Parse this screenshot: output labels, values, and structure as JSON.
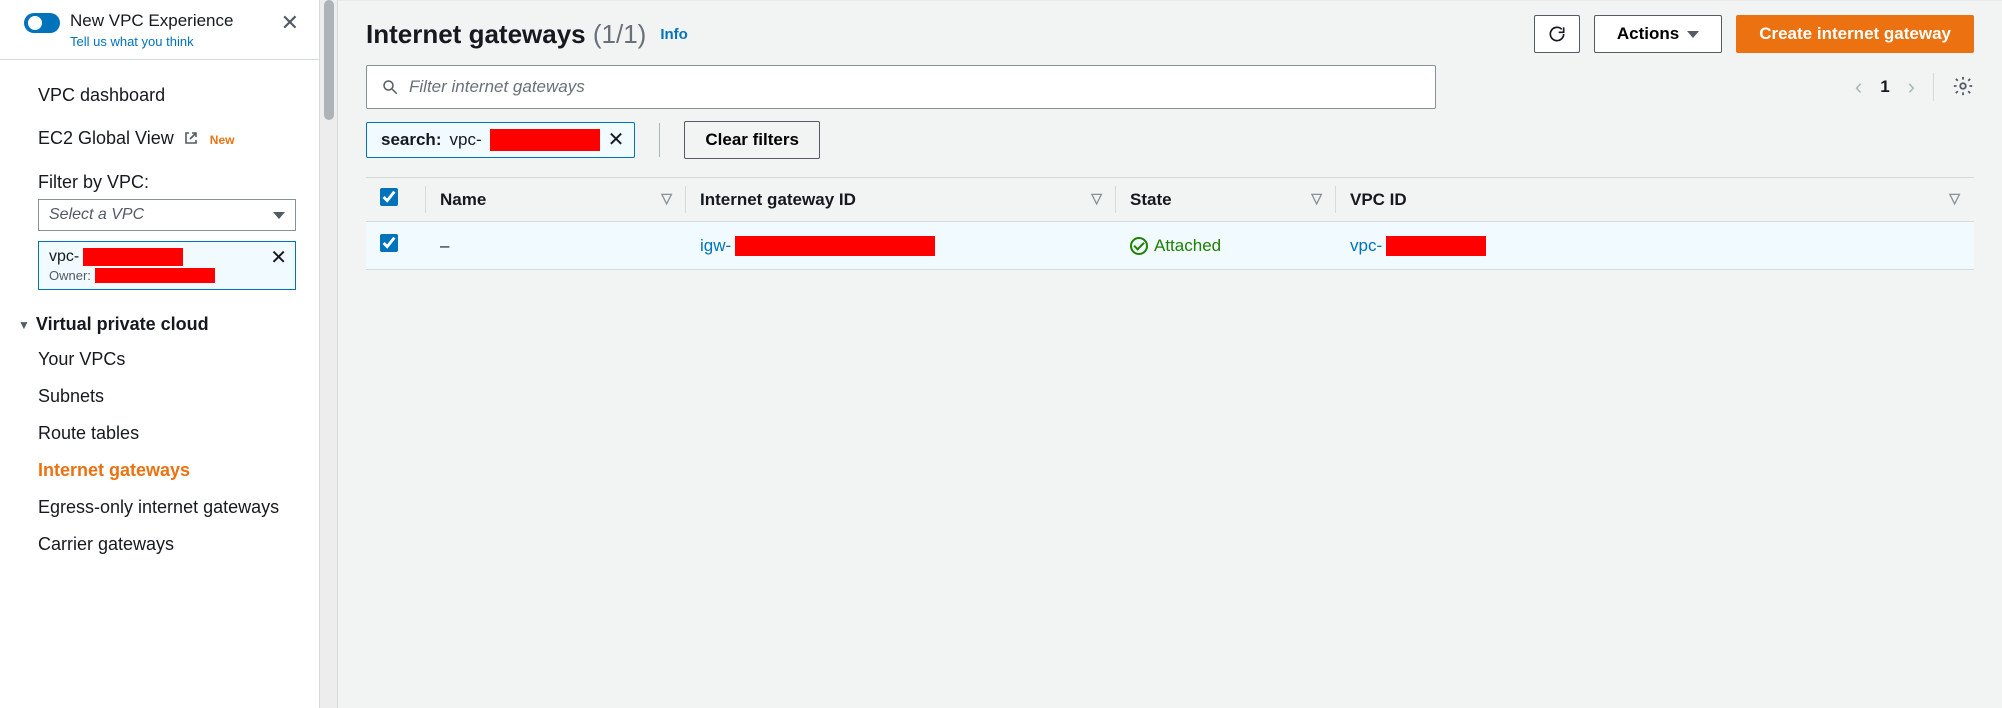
{
  "sidebar": {
    "toggle_title": "New VPC Experience",
    "toggle_sub": "Tell us what you think",
    "dashboard": "VPC dashboard",
    "ec2_global": "EC2 Global View",
    "new_badge": "New",
    "filter_label": "Filter by VPC:",
    "select_placeholder": "Select a VPC",
    "chip_prefix": "vpc-",
    "chip_owner_label": "Owner:",
    "section_title": "Virtual private cloud",
    "items": [
      "Your VPCs",
      "Subnets",
      "Route tables",
      "Internet gateways",
      "Egress-only internet gateways",
      "Carrier gateways"
    ],
    "active_index": 3
  },
  "header": {
    "title": "Internet gateways",
    "count": "(1/1)",
    "info": "Info",
    "refresh_label": "Refresh",
    "actions_label": "Actions",
    "create_label": "Create internet gateway"
  },
  "search": {
    "placeholder": "Filter internet gateways",
    "chip_label": "search:",
    "chip_value_prefix": "vpc-",
    "clear_label": "Clear filters",
    "page_current": "1"
  },
  "table": {
    "columns": [
      "Name",
      "Internet gateway ID",
      "State",
      "VPC ID"
    ],
    "row": {
      "name": "–",
      "igw_prefix": "igw-",
      "state": "Attached",
      "vpc_prefix": "vpc-"
    }
  }
}
